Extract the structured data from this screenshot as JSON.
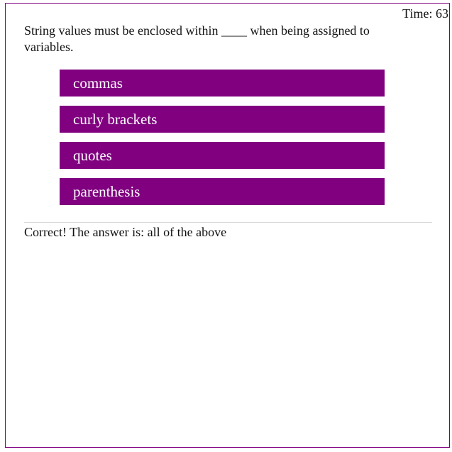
{
  "timer": {
    "text": "Time: 63"
  },
  "question": {
    "text": "String values must be enclosed within ____ when being assigned to variables."
  },
  "choices": [
    {
      "label": "commas"
    },
    {
      "label": "curly brackets"
    },
    {
      "label": "quotes"
    },
    {
      "label": "parenthesis"
    }
  ],
  "feedback": {
    "text": "Correct! The answer is: all of the above"
  },
  "colors": {
    "accent": "#800080",
    "button_text": "#ffffff",
    "divider": "#d9d9d9"
  }
}
